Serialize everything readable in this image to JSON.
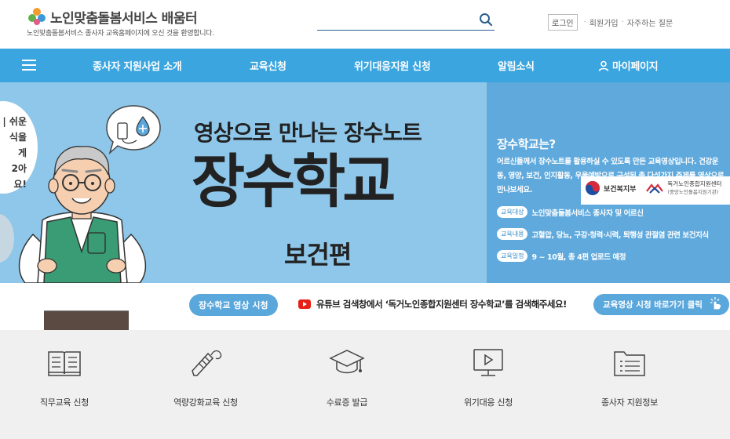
{
  "header": {
    "logo_title": "노인맞춤돌봄서비스 배움터",
    "logo_subtitle": "노인맞춤돌봄서비스 종사자 교육홈페이지에 오신 것을 환영합니다.",
    "search_placeholder": "",
    "login_label": "로그인",
    "signup_label": "회원가입",
    "faq_label": "자주하는 질문"
  },
  "nav": {
    "items": [
      {
        "label": "종사자 지원사업 소개"
      },
      {
        "label": "교육신청"
      },
      {
        "label": "위기대응지원 신청"
      },
      {
        "label": "알림소식"
      },
      {
        "label": "마이페이지"
      }
    ]
  },
  "banner": {
    "subtitle": "영상으로 만나는 장수노트",
    "title": "장수학교",
    "edition": "보건편",
    "bubble_lines": [
      "| 쉬운",
      "식을",
      "게",
      "2아요!"
    ],
    "gov_logo_1": "보건복지부",
    "gov_logo_2_line1": "독거노인종합지원센터",
    "gov_logo_2_line2": "(중앙노인돌봄지원기관)",
    "right_heading": "장수학교는?",
    "right_desc": "어르신들께서 장수노트를 활용하실 수 있도록 만든 교육영상입니다. 건강운동, 영양, 보건, 인지활동, 우울예방으로 구성된 총 다섯가지 주제를 영상으로 만나보세요.",
    "rows": [
      {
        "tag": "교육대상",
        "value": "노인맞춤돌봄서비스 종사자 및 어르신"
      },
      {
        "tag": "교육내용",
        "value": "고혈압, 당뇨, 구강·청력·시력, 퇴행성 관절염 관련 보건지식"
      },
      {
        "tag": "교육일정",
        "value": "9 ~ 10월, 총 4편 업로드 예정"
      }
    ]
  },
  "strip": {
    "pill_label": "장수학교 영상 시청",
    "text": "유튜브 검색창에서 ‘독거노인종합지원센터 장수학교’를 검색해주세요!",
    "button_label": "교육영상 시청 바로가기 클릭"
  },
  "quick": {
    "items": [
      {
        "label": "직무교육 신청",
        "icon": "book-icon"
      },
      {
        "label": "역량강화교육 신청",
        "icon": "pencil-icon"
      },
      {
        "label": "수료증 발급",
        "icon": "graduation-cap-icon"
      },
      {
        "label": "위기대응 신청",
        "icon": "monitor-play-icon"
      },
      {
        "label": "종사자 지원정보",
        "icon": "folder-list-icon"
      }
    ]
  },
  "colors": {
    "nav_bg": "#3aa5df",
    "banner_bg": "#8ec7ea",
    "banner_right_bg": "#5fa9dc",
    "quick_bg": "#f0f0f0",
    "vest_green": "#3a9c74"
  }
}
